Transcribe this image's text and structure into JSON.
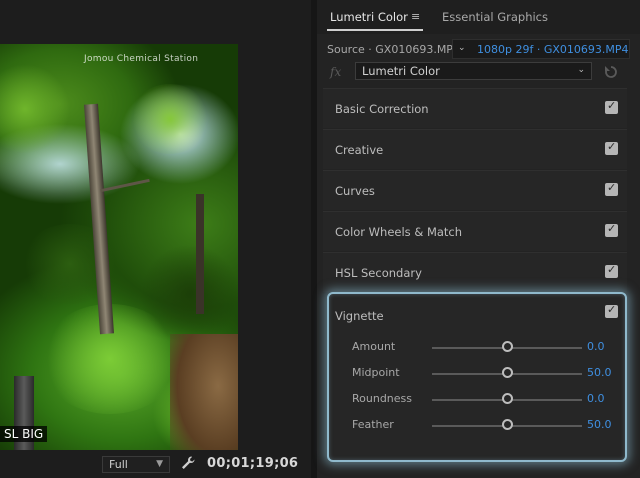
{
  "program_monitor": {
    "watermark": "Jomou Chemical Station",
    "overlay_text": "SL BIG",
    "zoom": "Full",
    "timecode": "00;01;19;06"
  },
  "lumetri": {
    "tabs": [
      {
        "label": "Lumetri Color",
        "active": true
      },
      {
        "label": "Essential Graphics",
        "active": false
      }
    ],
    "menu_icon": "hamburger-menu-icon",
    "source_label": "Source · GX010693.MP4",
    "sequence_label": "1080p 29f · GX010693.MP4",
    "effect_select": "Lumetri Color",
    "sections": [
      {
        "label": "Basic Correction",
        "checked": true
      },
      {
        "label": "Creative",
        "checked": true
      },
      {
        "label": "Curves",
        "checked": true
      },
      {
        "label": "Color Wheels & Match",
        "checked": true
      },
      {
        "label": "HSL Secondary",
        "checked": true
      }
    ],
    "vignette": {
      "label": "Vignette",
      "checked": true,
      "sliders": [
        {
          "label": "Amount",
          "value": "0.0",
          "fraction": 0.5
        },
        {
          "label": "Midpoint",
          "value": "50.0",
          "fraction": 0.5
        },
        {
          "label": "Roundness",
          "value": "0.0",
          "fraction": 0.5
        },
        {
          "label": "Feather",
          "value": "50.0",
          "fraction": 0.5
        }
      ]
    },
    "colors": {
      "accent_blue": "#3f8fe0",
      "highlight_glow": "#8fb9cc"
    }
  }
}
